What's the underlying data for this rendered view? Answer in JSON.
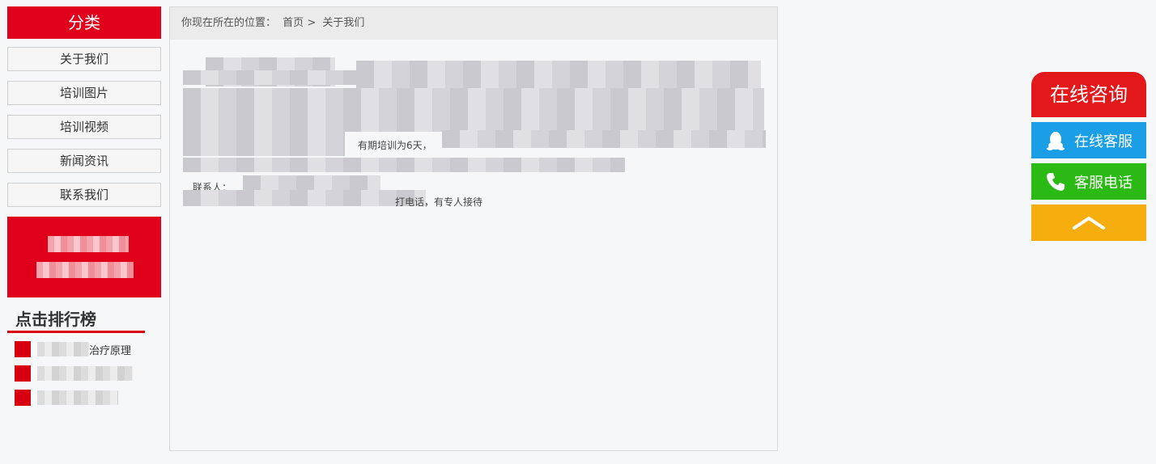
{
  "sidebar": {
    "category_title": "分类",
    "categories": [
      {
        "label": "关于我们"
      },
      {
        "label": "培训图片"
      },
      {
        "label": "培训视频"
      },
      {
        "label": "新闻资讯"
      },
      {
        "label": "联系我们"
      }
    ],
    "rank_title": "点击排行榜",
    "rank_items": [
      {
        "visible_text": "治疗原理"
      },
      {
        "visible_text": ""
      },
      {
        "visible_text": ""
      }
    ]
  },
  "breadcrumb": {
    "prefix": "你现在所在的位置：",
    "home": "首页",
    "separator": ">",
    "current": "关于我们"
  },
  "content": {
    "visible_fragments": {
      "line_training": "有期培训为6天，",
      "line_contact_label": "联系人：",
      "line_last": "打电话，有专人接待"
    }
  },
  "float_widget": {
    "title": "在线咨询",
    "qq_label": "在线客服",
    "phone_label": "客服电话",
    "colors": {
      "title_bg": "#e3181b",
      "qq_bg": "#1a9ee5",
      "phone_bg": "#2bba14",
      "top_bg": "#f6ae0e"
    }
  },
  "colors": {
    "brand_red": "#e0001b",
    "page_bg": "#f6f7f8"
  }
}
